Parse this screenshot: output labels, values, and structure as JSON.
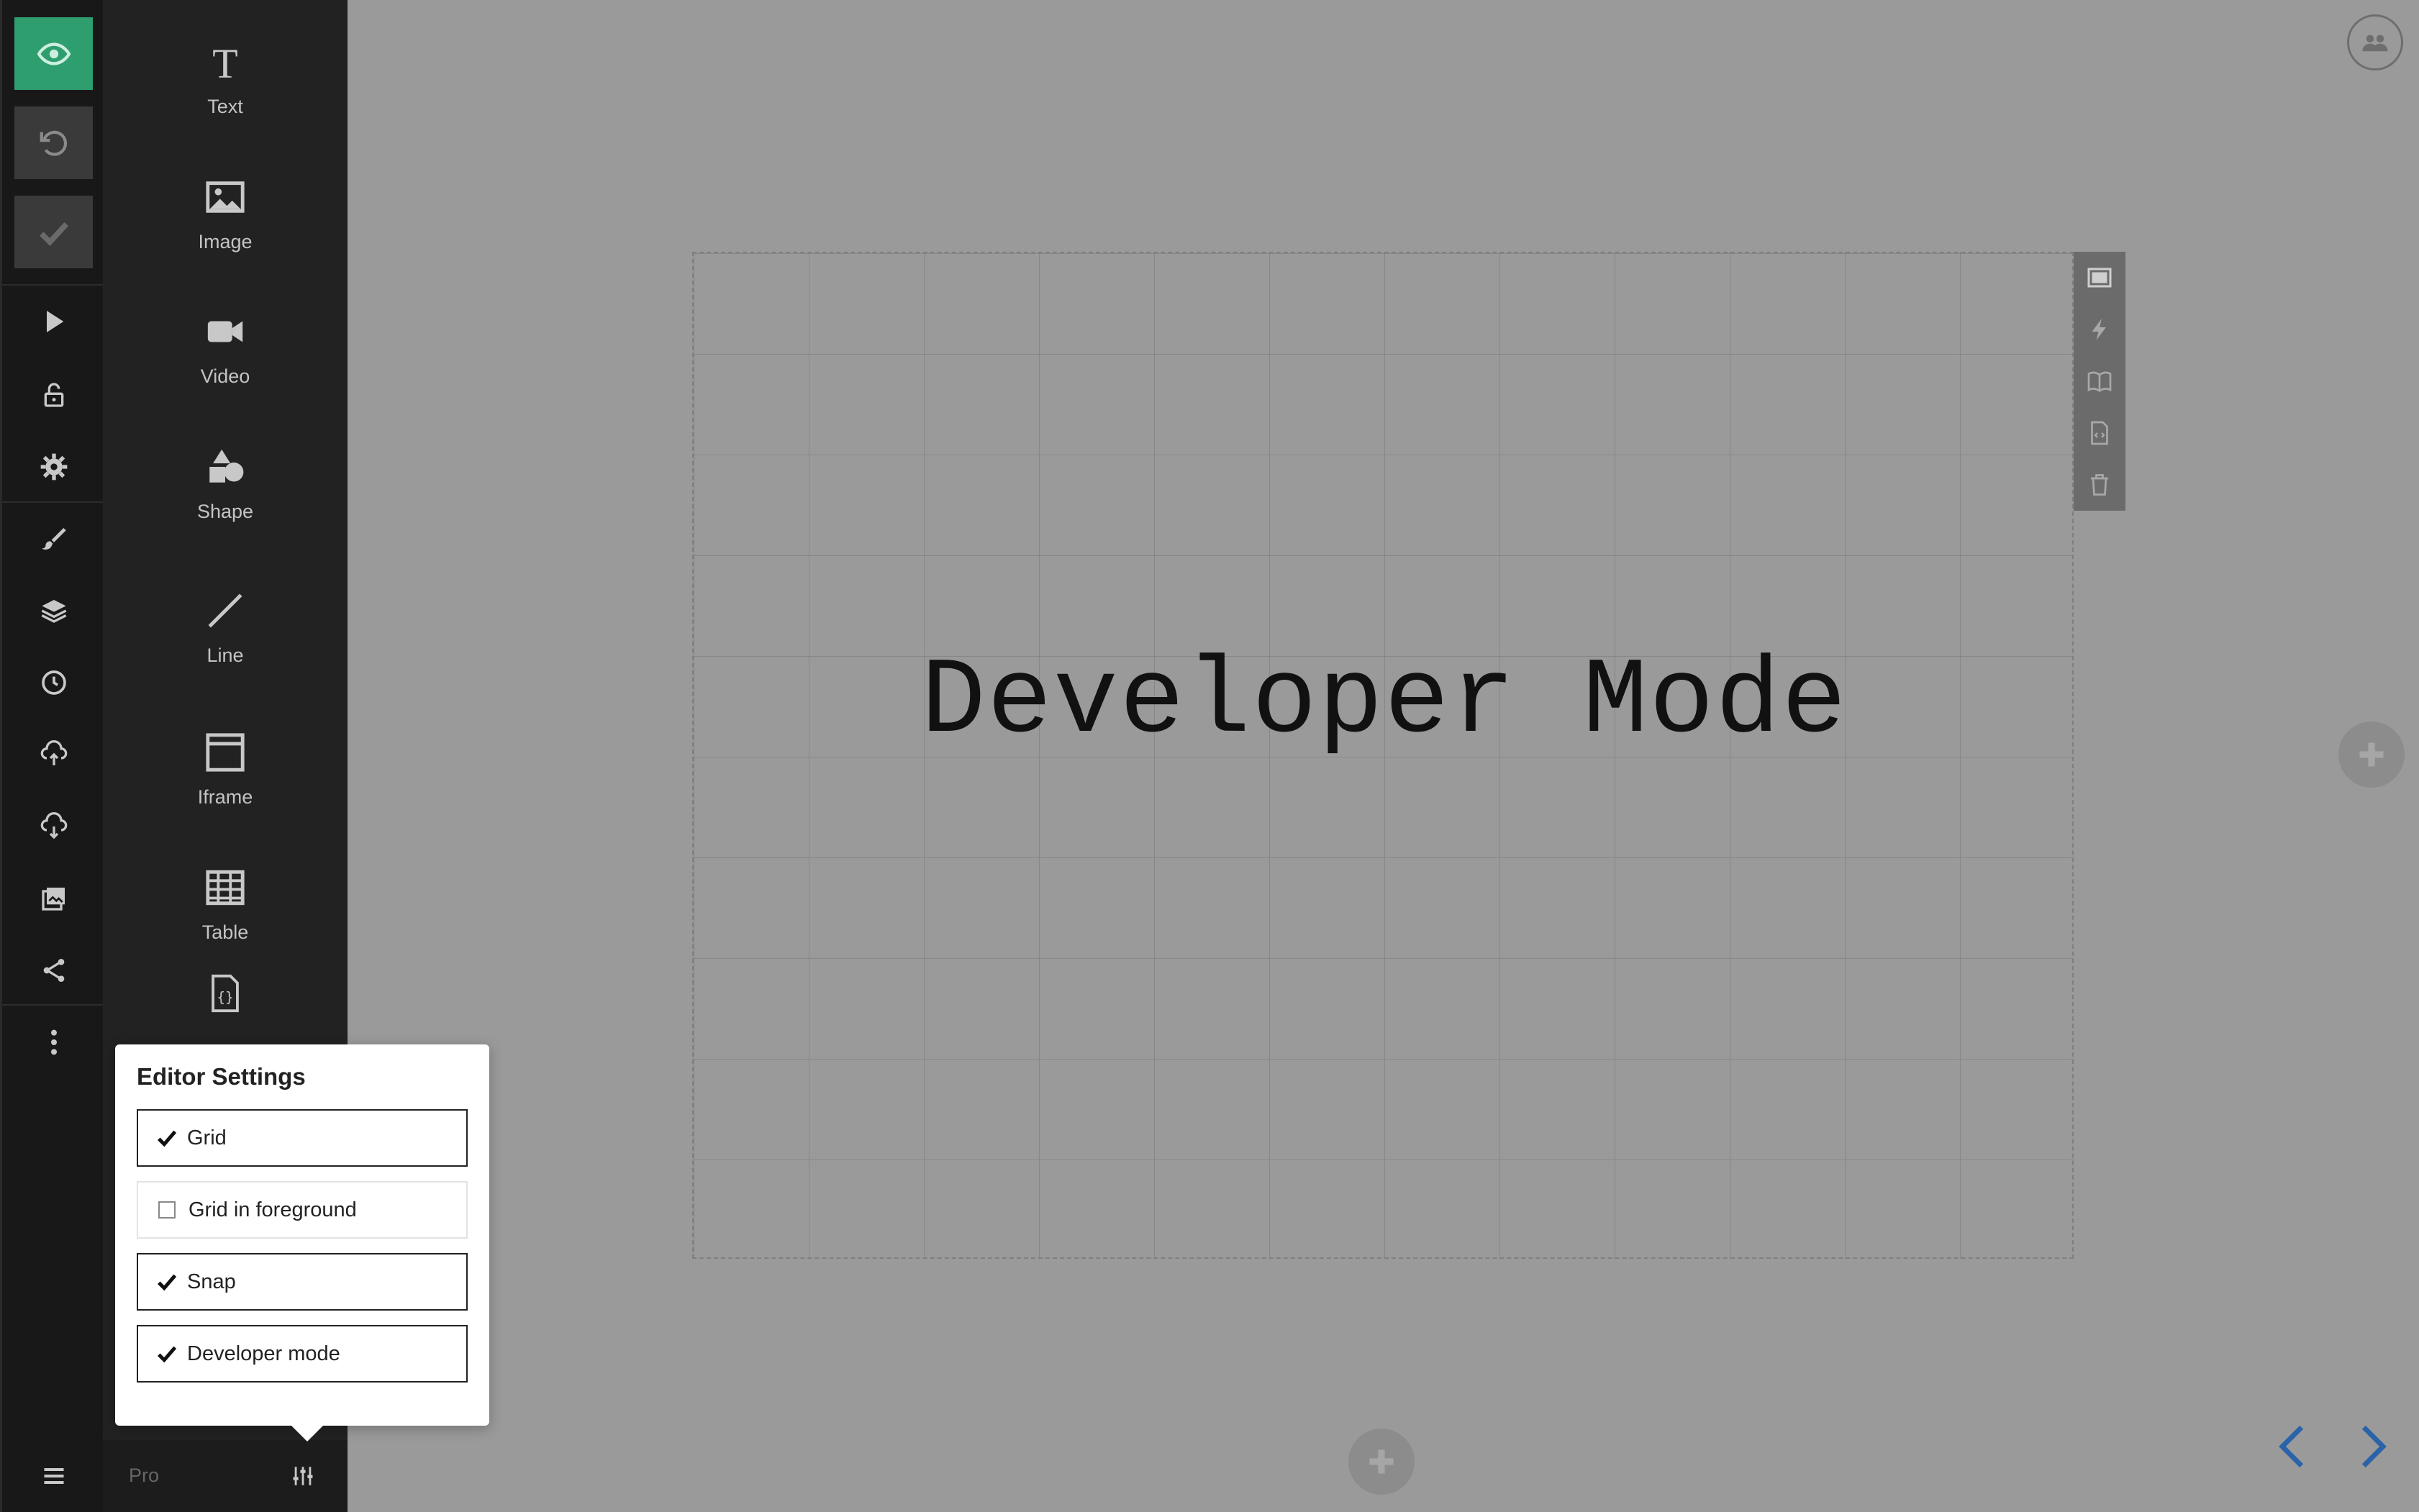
{
  "sidebar": {
    "rail": [
      {
        "name": "preview",
        "icon": "eye-icon"
      },
      {
        "name": "undo",
        "icon": "undo-icon"
      },
      {
        "name": "save",
        "icon": "checkmark-icon"
      },
      {
        "name": "present",
        "icon": "play-icon"
      },
      {
        "name": "lock",
        "icon": "lock-icon"
      },
      {
        "name": "settings",
        "icon": "gear-icon"
      },
      {
        "name": "style",
        "icon": "brush-icon"
      },
      {
        "name": "layers",
        "icon": "layers-icon"
      },
      {
        "name": "history",
        "icon": "clock-icon"
      },
      {
        "name": "import",
        "icon": "cloud-upload-icon"
      },
      {
        "name": "export",
        "icon": "cloud-download-icon"
      },
      {
        "name": "media",
        "icon": "images-icon"
      },
      {
        "name": "share",
        "icon": "share-icon"
      },
      {
        "name": "more",
        "icon": "more-vertical-icon"
      }
    ],
    "menu_icon": "hamburger-icon"
  },
  "insert_panel": {
    "tools": [
      {
        "label": "Text",
        "icon": "text-icon"
      },
      {
        "label": "Image",
        "icon": "image-icon"
      },
      {
        "label": "Video",
        "icon": "video-icon"
      },
      {
        "label": "Shape",
        "icon": "shape-icon"
      },
      {
        "label": "Line",
        "icon": "line-icon"
      },
      {
        "label": "Iframe",
        "icon": "iframe-icon"
      },
      {
        "label": "Table",
        "icon": "table-icon"
      },
      {
        "label": "",
        "icon": "code-file-icon"
      }
    ],
    "footer": {
      "plan_label": "Pro",
      "settings_icon": "sliders-icon"
    }
  },
  "editor_settings": {
    "title": "Editor Settings",
    "options": [
      {
        "label": "Grid",
        "checked": true
      },
      {
        "label": "Grid in foreground",
        "checked": false
      },
      {
        "label": "Snap",
        "checked": true
      },
      {
        "label": "Developer mode",
        "checked": true
      }
    ]
  },
  "slide": {
    "text": "Developer Mode",
    "toolbar": [
      "slide-background-icon",
      "lightning-icon",
      "notes-book-icon",
      "code-file-icon",
      "trash-icon"
    ]
  },
  "colors": {
    "accent": "#2f9e6f",
    "nav_arrow": "#2a63a8",
    "canvas_bg": "#9a9a9a"
  }
}
